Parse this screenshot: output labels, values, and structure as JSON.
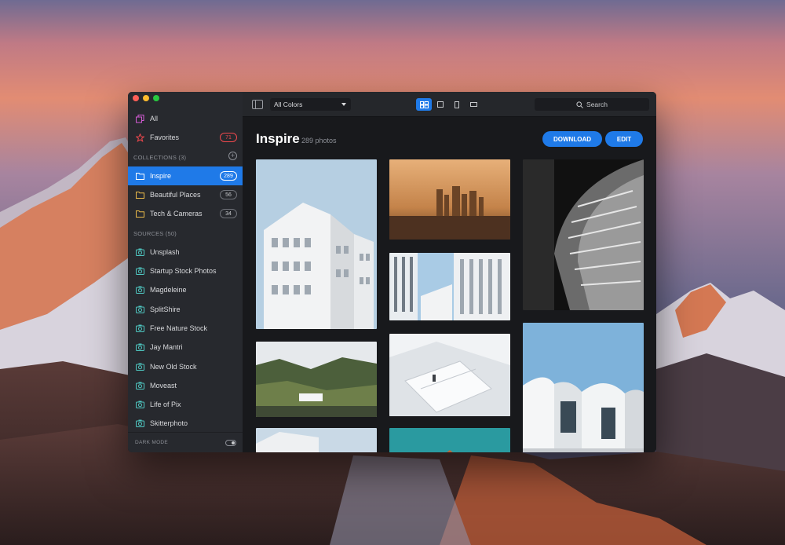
{
  "app": {
    "sidebar": {
      "top_items": [
        {
          "label": "All",
          "icon": "stack-icon"
        },
        {
          "label": "Favorites",
          "icon": "star-icon",
          "count": "71"
        }
      ],
      "collections_header": "COLLECTIONS (3)",
      "collections": [
        {
          "label": "Inspire",
          "count": "289",
          "active": true
        },
        {
          "label": "Beautiful Places",
          "count": "56"
        },
        {
          "label": "Tech & Cameras",
          "count": "34"
        }
      ],
      "sources_header": "SOURCES (50)",
      "sources": [
        {
          "label": "Unsplash"
        },
        {
          "label": "Startup Stock Photos"
        },
        {
          "label": "Magdeleine"
        },
        {
          "label": "SplitShire"
        },
        {
          "label": "Free Nature Stock"
        },
        {
          "label": "Jay Mantri"
        },
        {
          "label": "New Old Stock"
        },
        {
          "label": "Moveast"
        },
        {
          "label": "Life of Pix"
        },
        {
          "label": "Skitterphoto"
        }
      ],
      "dark_mode_label": "DARK MODE"
    },
    "toolbar": {
      "color_filter": "All Colors",
      "search_placeholder": "Search"
    },
    "main": {
      "title": "Inspire",
      "photo_count": "289 photos",
      "download_label": "DOWNLOAD",
      "edit_label": "EDIT"
    },
    "colors": {
      "accent": "#1f7ae8",
      "favorites_badge": "#f0484d",
      "folder": "#e9b949",
      "source_icon": "#4fc7c1"
    }
  }
}
